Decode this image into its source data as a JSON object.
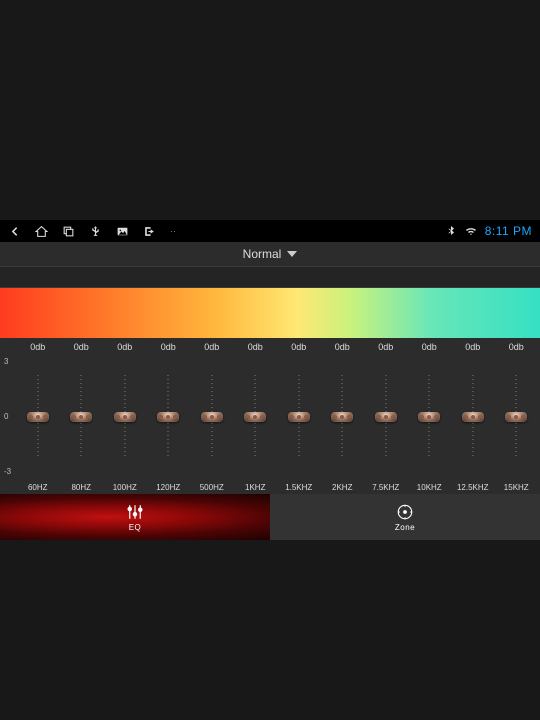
{
  "status": {
    "clock": "8:11 PM"
  },
  "preset": {
    "label": "Normal"
  },
  "scale": {
    "top": "3",
    "mid": "0",
    "bot": "-3"
  },
  "bands": [
    {
      "db": "0db",
      "freq": "60HZ"
    },
    {
      "db": "0db",
      "freq": "80HZ"
    },
    {
      "db": "0db",
      "freq": "100HZ"
    },
    {
      "db": "0db",
      "freq": "120HZ"
    },
    {
      "db": "0db",
      "freq": "500HZ"
    },
    {
      "db": "0db",
      "freq": "1KHZ"
    },
    {
      "db": "0db",
      "freq": "1.5KHZ"
    },
    {
      "db": "0db",
      "freq": "2KHZ"
    },
    {
      "db": "0db",
      "freq": "7.5KHZ"
    },
    {
      "db": "0db",
      "freq": "10KHZ"
    },
    {
      "db": "0db",
      "freq": "12.5KHZ"
    },
    {
      "db": "0db",
      "freq": "15KHZ"
    }
  ],
  "tabs": {
    "eq": "EQ",
    "zone": "Zone"
  }
}
